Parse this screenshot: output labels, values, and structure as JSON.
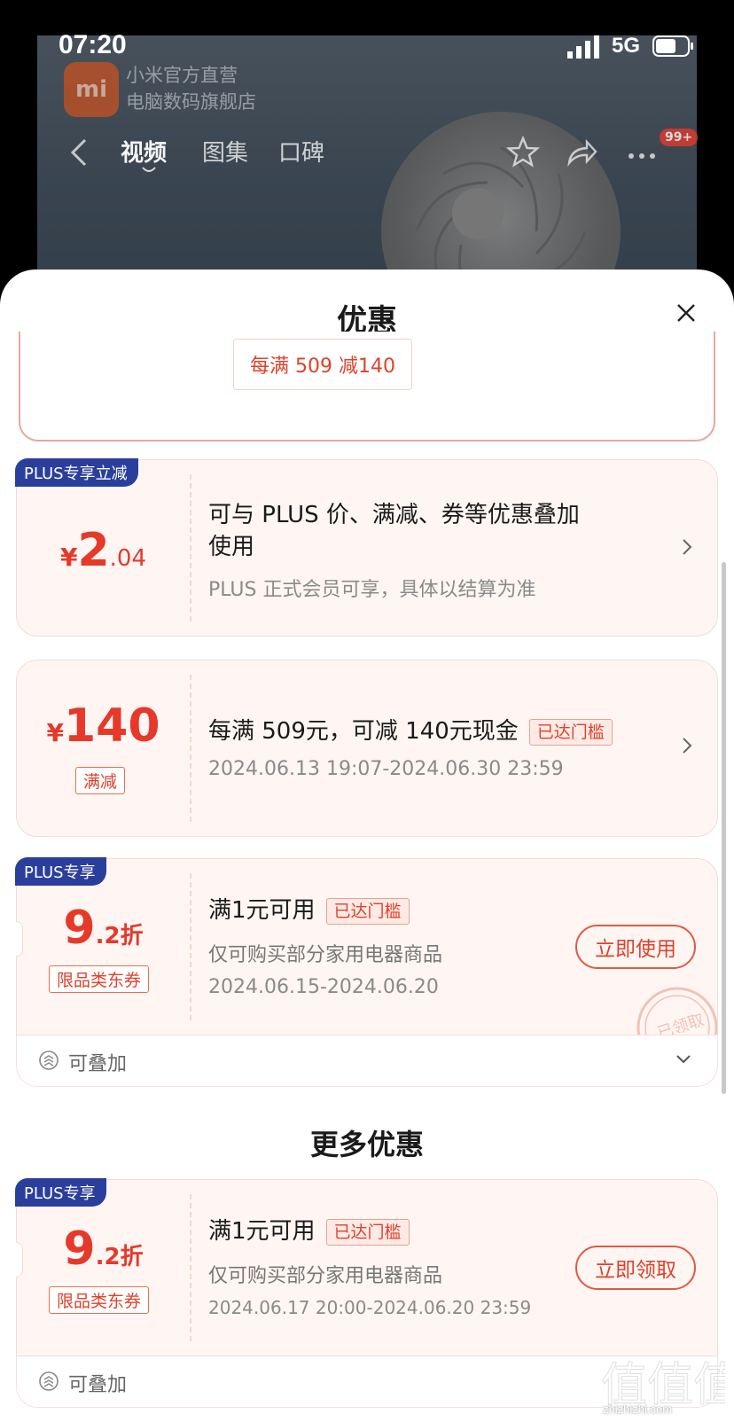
{
  "status_bar": {
    "time": "07:20",
    "network": "5G"
  },
  "background": {
    "store_logo": "mi",
    "store_name_line1": "小米官方直营",
    "store_name_line2": "电脑数码旗舰店",
    "tabs": [
      "视频",
      "图集",
      "口碑"
    ],
    "active_tab": "视频",
    "message_badge": "99+"
  },
  "sheet": {
    "title": "优惠",
    "top_chip": "每满 509 减140",
    "card1": {
      "tag": "PLUS专享立减",
      "currency": "¥",
      "amount_int": "2",
      "amount_dec": ".04",
      "line1": "可与 PLUS 价、满减、券等优惠叠加",
      "line2": "使用",
      "sub": "PLUS 正式会员可享，具体以结算为准"
    },
    "card2": {
      "currency": "¥",
      "amount": "140",
      "type_label": "满减",
      "main": "每满 509元，可减 140元现金",
      "reached": "已达门槛",
      "date": "2024.06.13 19:07-2024.06.30 23:59"
    },
    "card3": {
      "tag": "PLUS专享",
      "discount_int": "9",
      "discount_dec": ".2",
      "discount_unit": "折",
      "type_label": "限品类东券",
      "main": "满1元可用",
      "reached": "已达门槛",
      "desc": "仅可购买部分家用电器商品",
      "date": "2024.06.15-2024.06.20",
      "button": "立即使用",
      "stamp": "已领取",
      "stack_label": "可叠加"
    },
    "more_title": "更多优惠",
    "card4": {
      "tag": "PLUS专享",
      "discount_int": "9",
      "discount_dec": ".2",
      "discount_unit": "折",
      "type_label": "限品类东券",
      "main": "满1元可用",
      "reached": "已达门槛",
      "desc": "仅可购买部分家用电器商品",
      "date": "2024.06.17 20:00-2024.06.20 23:59",
      "button": "立即领取",
      "stack_label": "可叠加"
    }
  },
  "watermark": {
    "text": "值值值",
    "url": "zhizhizhi.com"
  },
  "colors": {
    "accent": "#e6392a",
    "plus_tag": "#2a3e9c",
    "card_bg": "#fff6f3"
  }
}
